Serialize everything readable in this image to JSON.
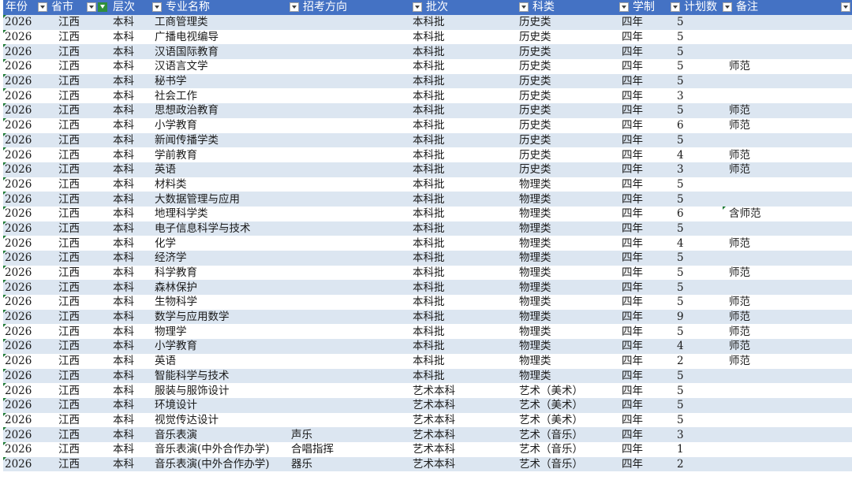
{
  "colors": {
    "header_bg": "#4472c4",
    "band_bg": "#dce6f1",
    "active_filter": "#2f8f3b"
  },
  "headers": {
    "year": "年份",
    "province": "省市",
    "level": "层次",
    "major": "专业名称",
    "direction": "招考方向",
    "batch": "批次",
    "category": "科类",
    "duration": "学制",
    "plan": "计划数",
    "note": "备注"
  },
  "filters": {
    "active_column": "level",
    "icon": "filter-funnel-icon"
  },
  "rows": [
    {
      "year": "2026",
      "province": "江西",
      "level": "本科",
      "major": "工商管理类",
      "direction": "",
      "batch": "本科批",
      "category": "历史类",
      "duration": "四年",
      "plan": "5",
      "note": ""
    },
    {
      "year": "2026",
      "province": "江西",
      "level": "本科",
      "major": "广播电视编导",
      "direction": "",
      "batch": "本科批",
      "category": "历史类",
      "duration": "四年",
      "plan": "5",
      "note": ""
    },
    {
      "year": "2026",
      "province": "江西",
      "level": "本科",
      "major": "汉语国际教育",
      "direction": "",
      "batch": "本科批",
      "category": "历史类",
      "duration": "四年",
      "plan": "5",
      "note": ""
    },
    {
      "year": "2026",
      "province": "江西",
      "level": "本科",
      "major": "汉语言文学",
      "direction": "",
      "batch": "本科批",
      "category": "历史类",
      "duration": "四年",
      "plan": "5",
      "note": "师范"
    },
    {
      "year": "2026",
      "province": "江西",
      "level": "本科",
      "major": "秘书学",
      "direction": "",
      "batch": "本科批",
      "category": "历史类",
      "duration": "四年",
      "plan": "5",
      "note": ""
    },
    {
      "year": "2026",
      "province": "江西",
      "level": "本科",
      "major": "社会工作",
      "direction": "",
      "batch": "本科批",
      "category": "历史类",
      "duration": "四年",
      "plan": "3",
      "note": ""
    },
    {
      "year": "2026",
      "province": "江西",
      "level": "本科",
      "major": "思想政治教育",
      "direction": "",
      "batch": "本科批",
      "category": "历史类",
      "duration": "四年",
      "plan": "5",
      "note": "师范"
    },
    {
      "year": "2026",
      "province": "江西",
      "level": "本科",
      "major": "小学教育",
      "direction": "",
      "batch": "本科批",
      "category": "历史类",
      "duration": "四年",
      "plan": "6",
      "note": "师范"
    },
    {
      "year": "2026",
      "province": "江西",
      "level": "本科",
      "major": "新闻传播学类",
      "direction": "",
      "batch": "本科批",
      "category": "历史类",
      "duration": "四年",
      "plan": "5",
      "note": ""
    },
    {
      "year": "2026",
      "province": "江西",
      "level": "本科",
      "major": "学前教育",
      "direction": "",
      "batch": "本科批",
      "category": "历史类",
      "duration": "四年",
      "plan": "4",
      "note": "师范"
    },
    {
      "year": "2026",
      "province": "江西",
      "level": "本科",
      "major": "英语",
      "direction": "",
      "batch": "本科批",
      "category": "历史类",
      "duration": "四年",
      "plan": "3",
      "note": "师范"
    },
    {
      "year": "2026",
      "province": "江西",
      "level": "本科",
      "major": "材料类",
      "direction": "",
      "batch": "本科批",
      "category": "物理类",
      "duration": "四年",
      "plan": "5",
      "note": ""
    },
    {
      "year": "2026",
      "province": "江西",
      "level": "本科",
      "major": "大数据管理与应用",
      "direction": "",
      "batch": "本科批",
      "category": "物理类",
      "duration": "四年",
      "plan": "5",
      "note": ""
    },
    {
      "year": "2026",
      "province": "江西",
      "level": "本科",
      "major": "地理科学类",
      "direction": "",
      "batch": "本科批",
      "category": "物理类",
      "duration": "四年",
      "plan": "6",
      "note": "含师范"
    },
    {
      "year": "2026",
      "province": "江西",
      "level": "本科",
      "major": "电子信息科学与技术",
      "direction": "",
      "batch": "本科批",
      "category": "物理类",
      "duration": "四年",
      "plan": "5",
      "note": ""
    },
    {
      "year": "2026",
      "province": "江西",
      "level": "本科",
      "major": "化学",
      "direction": "",
      "batch": "本科批",
      "category": "物理类",
      "duration": "四年",
      "plan": "4",
      "note": "师范"
    },
    {
      "year": "2026",
      "province": "江西",
      "level": "本科",
      "major": "经济学",
      "direction": "",
      "batch": "本科批",
      "category": "物理类",
      "duration": "四年",
      "plan": "5",
      "note": ""
    },
    {
      "year": "2026",
      "province": "江西",
      "level": "本科",
      "major": "科学教育",
      "direction": "",
      "batch": "本科批",
      "category": "物理类",
      "duration": "四年",
      "plan": "5",
      "note": "师范"
    },
    {
      "year": "2026",
      "province": "江西",
      "level": "本科",
      "major": "森林保护",
      "direction": "",
      "batch": "本科批",
      "category": "物理类",
      "duration": "四年",
      "plan": "5",
      "note": ""
    },
    {
      "year": "2026",
      "province": "江西",
      "level": "本科",
      "major": "生物科学",
      "direction": "",
      "batch": "本科批",
      "category": "物理类",
      "duration": "四年",
      "plan": "5",
      "note": "师范"
    },
    {
      "year": "2026",
      "province": "江西",
      "level": "本科",
      "major": "数学与应用数学",
      "direction": "",
      "batch": "本科批",
      "category": "物理类",
      "duration": "四年",
      "plan": "9",
      "note": "师范"
    },
    {
      "year": "2026",
      "province": "江西",
      "level": "本科",
      "major": "物理学",
      "direction": "",
      "batch": "本科批",
      "category": "物理类",
      "duration": "四年",
      "plan": "5",
      "note": "师范"
    },
    {
      "year": "2026",
      "province": "江西",
      "level": "本科",
      "major": "小学教育",
      "direction": "",
      "batch": "本科批",
      "category": "物理类",
      "duration": "四年",
      "plan": "4",
      "note": "师范"
    },
    {
      "year": "2026",
      "province": "江西",
      "level": "本科",
      "major": "英语",
      "direction": "",
      "batch": "本科批",
      "category": "物理类",
      "duration": "四年",
      "plan": "2",
      "note": "师范"
    },
    {
      "year": "2026",
      "province": "江西",
      "level": "本科",
      "major": "智能科学与技术",
      "direction": "",
      "batch": "本科批",
      "category": "物理类",
      "duration": "四年",
      "plan": "5",
      "note": ""
    },
    {
      "year": "2026",
      "province": "江西",
      "level": "本科",
      "major": "服装与服饰设计",
      "direction": "",
      "batch": "艺术本科",
      "category": "艺术（美术）",
      "duration": "四年",
      "plan": "5",
      "note": ""
    },
    {
      "year": "2026",
      "province": "江西",
      "level": "本科",
      "major": "环境设计",
      "direction": "",
      "batch": "艺术本科",
      "category": "艺术（美术）",
      "duration": "四年",
      "plan": "5",
      "note": ""
    },
    {
      "year": "2026",
      "province": "江西",
      "level": "本科",
      "major": "视觉传达设计",
      "direction": "",
      "batch": "艺术本科",
      "category": "艺术（美术）",
      "duration": "四年",
      "plan": "5",
      "note": ""
    },
    {
      "year": "2026",
      "province": "江西",
      "level": "本科",
      "major": "音乐表演",
      "direction": "声乐",
      "batch": "艺术本科",
      "category": "艺术（音乐）",
      "duration": "四年",
      "plan": "3",
      "note": ""
    },
    {
      "year": "2026",
      "province": "江西",
      "level": "本科",
      "major": "音乐表演(中外合作办学)",
      "direction": "合唱指挥",
      "batch": "艺术本科",
      "category": "艺术（音乐）",
      "duration": "四年",
      "plan": "1",
      "note": ""
    },
    {
      "year": "2026",
      "province": "江西",
      "level": "本科",
      "major": "音乐表演(中外合作办学)",
      "direction": "器乐",
      "batch": "艺术本科",
      "category": "艺术（音乐）",
      "duration": "四年",
      "plan": "2",
      "note": ""
    }
  ]
}
